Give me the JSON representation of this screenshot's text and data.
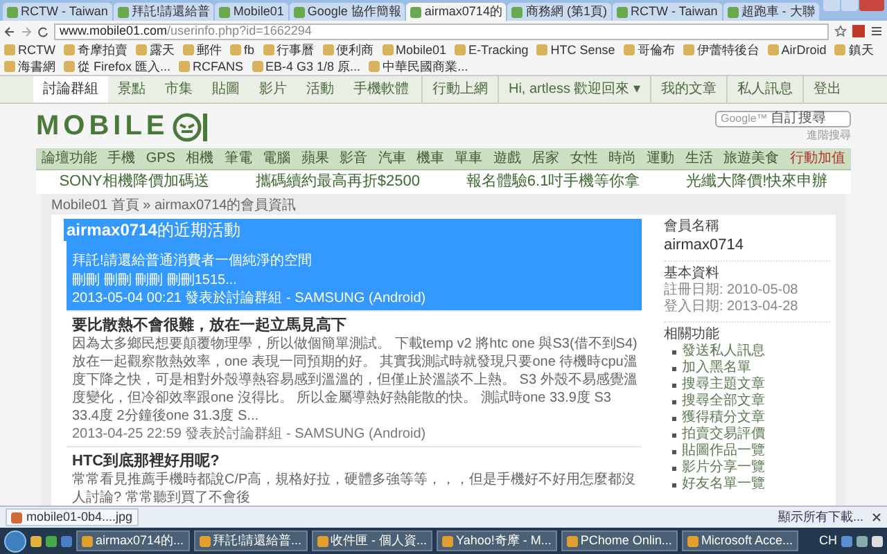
{
  "browser": {
    "tabs": [
      {
        "label": "RCTW - Taiwan",
        "selected": false
      },
      {
        "label": "拜託!請還給普",
        "selected": false
      },
      {
        "label": "Mobile01",
        "selected": false
      },
      {
        "label": "Google 協作簡報",
        "selected": false
      },
      {
        "label": "airmax0714的",
        "selected": true
      },
      {
        "label": "商務網 (第1頁)",
        "selected": false
      },
      {
        "label": "RCTW - Taiwan",
        "selected": false
      },
      {
        "label": "超跑車 - 大聯",
        "selected": false
      }
    ],
    "address": {
      "host": "www.mobile01.com",
      "path": "/userinfo.php?id=1662294"
    },
    "bookmarks": [
      "RCTW",
      "奇摩拍賣",
      "露天",
      "郵件",
      "fb",
      "行事曆",
      "便利商",
      "Mobile01",
      "E-Tracking",
      "HTC Sense",
      "哥倫布",
      "伊蕾特後台",
      "AirDroid",
      "鎮天",
      "海書網",
      "從 Firefox 匯入...",
      "RCFANS",
      "EB-4 G3 1/8 原...",
      "中華民國商業..."
    ]
  },
  "site_nav": {
    "left": [
      {
        "label": "討論群組",
        "selected": true
      },
      {
        "label": "景點",
        "selected": false
      },
      {
        "label": "市集",
        "selected": false
      },
      {
        "label": "貼圖",
        "selected": false
      },
      {
        "label": "影片",
        "selected": false
      },
      {
        "label": "活動",
        "selected": false
      },
      {
        "label": "手機軟體",
        "selected": false
      }
    ],
    "right": [
      "行動上網",
      "Hi, artless 歡迎回來 ▾",
      "我的文章",
      "私人訊息",
      "登出"
    ]
  },
  "logo": "MOBILE",
  "search": {
    "brand": "Google™",
    "placeholder": "自訂搜尋",
    "advanced": "進階搜尋"
  },
  "categories": [
    {
      "label": "論壇功能",
      "highlight": false
    },
    {
      "label": "手機",
      "highlight": false
    },
    {
      "label": "GPS",
      "highlight": false
    },
    {
      "label": "相機",
      "highlight": false
    },
    {
      "label": "筆電",
      "highlight": false
    },
    {
      "label": "電腦",
      "highlight": false
    },
    {
      "label": "蘋果",
      "highlight": false
    },
    {
      "label": "影音",
      "highlight": false
    },
    {
      "label": "汽車",
      "highlight": false
    },
    {
      "label": "機車",
      "highlight": false
    },
    {
      "label": "單車",
      "highlight": false
    },
    {
      "label": "遊戲",
      "highlight": false
    },
    {
      "label": "居家",
      "highlight": false
    },
    {
      "label": "女性",
      "highlight": false
    },
    {
      "label": "時尚",
      "highlight": false
    },
    {
      "label": "運動",
      "highlight": false
    },
    {
      "label": "生活",
      "highlight": false
    },
    {
      "label": "旅遊美食",
      "highlight": false
    },
    {
      "label": "行動加值",
      "highlight": true
    }
  ],
  "promos": [
    "SONY相機降價加碼送",
    "攜碼續約最高再折$2500",
    "報名體驗6.1吋手機等你拿",
    "光纖大降價!快來申辦"
  ],
  "breadcrumb": "Mobile01 首頁 » airmax0714的會員資訊",
  "activity": {
    "heading": "**airmax0714**的近期活動",
    "posts": [
      {
        "title": "拜託!請還給普通消費者一個純淨的空間",
        "body": "刪刪 刪刪 刪刪 刪刪1515...",
        "meta": "2013-05-04 00:21 發表於討論群組 - SAMSUNG (Android)",
        "selected": true
      },
      {
        "title": "要比散熱不會很難，放在一起立馬見高下",
        "body": "因為太多鄉民想要顛覆物理學，所以做個簡單測試。 下載temp v2 將htc one 與S3(借不到S4) 放在一起觀察散熱效率，one 表現一同預期的好。 其實我測試時就發現只要one 待機時cpu溫度下降之快，可是相對外殼導熱容易感到溫溫的，但僅止於溫談不上熱。 S3 外殼不易感覺溫度變化，但冷卻效率跟one 沒得比。 所以金屬導熱好熱能散的快。 測試時one 33.9度 S3 33.4度 2分鐘後one 31.3度 S...",
        "meta": "2013-04-25 22:59 發表於討論群組 - SAMSUNG (Android)",
        "selected": false
      },
      {
        "title": "HTC到底那裡好用呢?",
        "body": "常常看見推薦手機時都說C/P高，規格好拉，硬體多強等等，，，但是手機好不好用怎麼都沒人討論? 常常聽到買了不會後",
        "selected": false
      }
    ]
  },
  "sidebar": {
    "name_label": "會員名稱",
    "name": "airmax0714",
    "info_label": "基本資料",
    "info": [
      "註冊日期: 2010-05-08",
      "登入日期: 2013-04-28"
    ],
    "links_label": "相關功能",
    "links": [
      "發送私人訊息",
      "加入黑名單",
      "搜尋主題文章",
      "搜尋全部文章",
      "獲得積分文章",
      "拍賣交易評價",
      "貼圖作品一覽",
      "影片分享一覽",
      "好友名單一覽"
    ]
  },
  "download_bar": {
    "file": "mobile01-0b4....jpg",
    "show_all": "顯示所有下載..."
  },
  "taskbar": {
    "items": [
      "airmax0714的...",
      "拜託!請還給普...",
      "收件匣 - 個人資...",
      "Yahoo!奇摩 - M...",
      "PChome Onlin...",
      "Microsoft Acce..."
    ],
    "input": "CH"
  }
}
